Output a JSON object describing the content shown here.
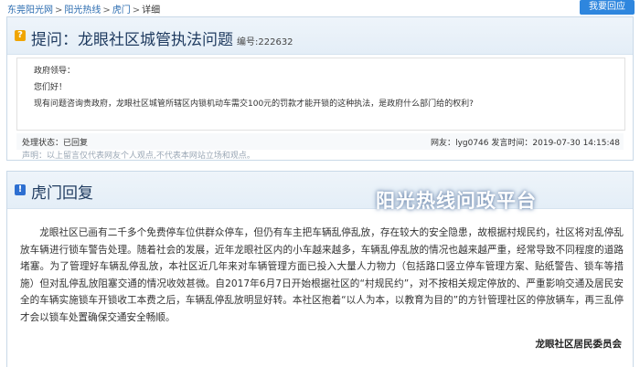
{
  "breadcrumb": {
    "items": [
      "东莞阳光网",
      "阳光热线",
      "虎门"
    ],
    "current": "详细",
    "separator": ">"
  },
  "ask_button": "我要回应",
  "question": {
    "prefix": "提问：",
    "title": "龙眼社区城管执法问题",
    "code_label": "编号:",
    "code": "222632",
    "greeting": "政府领导：",
    "hello": "您们好！",
    "body": "现有问题咨询贵政府，龙眼社区城管所辖区内锁机动车需交100元的罚款才能开锁的这种执法，是政府什么部门给的权利?",
    "status_label": "处理状态：",
    "status_value": "已回复",
    "netizen_label": "网友：",
    "netizen": "lyg0746",
    "time_label": "发言时间：",
    "time": "2019-07-30 14:15:48",
    "disclaimer": "声明：以上留言仅代表网友个人观点,不代表本网站立场和观点。"
  },
  "reply": {
    "title": "虎门回复",
    "watermark": "阳光热线问政平台",
    "body": "龙眼社区已画有二千多个免费停车位供群众停车，但仍有车主把车辆乱停乱放，存在较大的安全隐患，故根据村规民约，社区将对乱停乱放车辆进行锁车警告处理。随着社会的发展，近年龙眼社区内的小车越来越多，车辆乱停乱放的情况也越来越严重，经常导致不同程度的道路堵塞。为了管理好车辆乱停乱放，本社区近几年来对车辆管理方面已投入大量人力物力（包括路口竖立停车管理方案、贴纸警告、锁车等措施）但对乱停乱放阻塞交通的情况收效甚微。自2017年6月7日开始根据社区的“村规民约”，对不按相关规定停放的、严重影响交通及居民安全的车辆实施锁车开锁收工本费之后，车辆乱停乱放明显好转。本社区抱着“以人为本，以教育为目的”的方针管理社区的停放辆车，再三乱停才会以锁车处置确保交通安全畅顺。",
    "signature": "龙眼社区居民委员会"
  },
  "colors": {
    "link": "#2b6cb0",
    "button": "#2e86de",
    "title": "#1e3a5f",
    "question_icon": "#f0a500",
    "reply_icon": "#2e6fd1"
  }
}
